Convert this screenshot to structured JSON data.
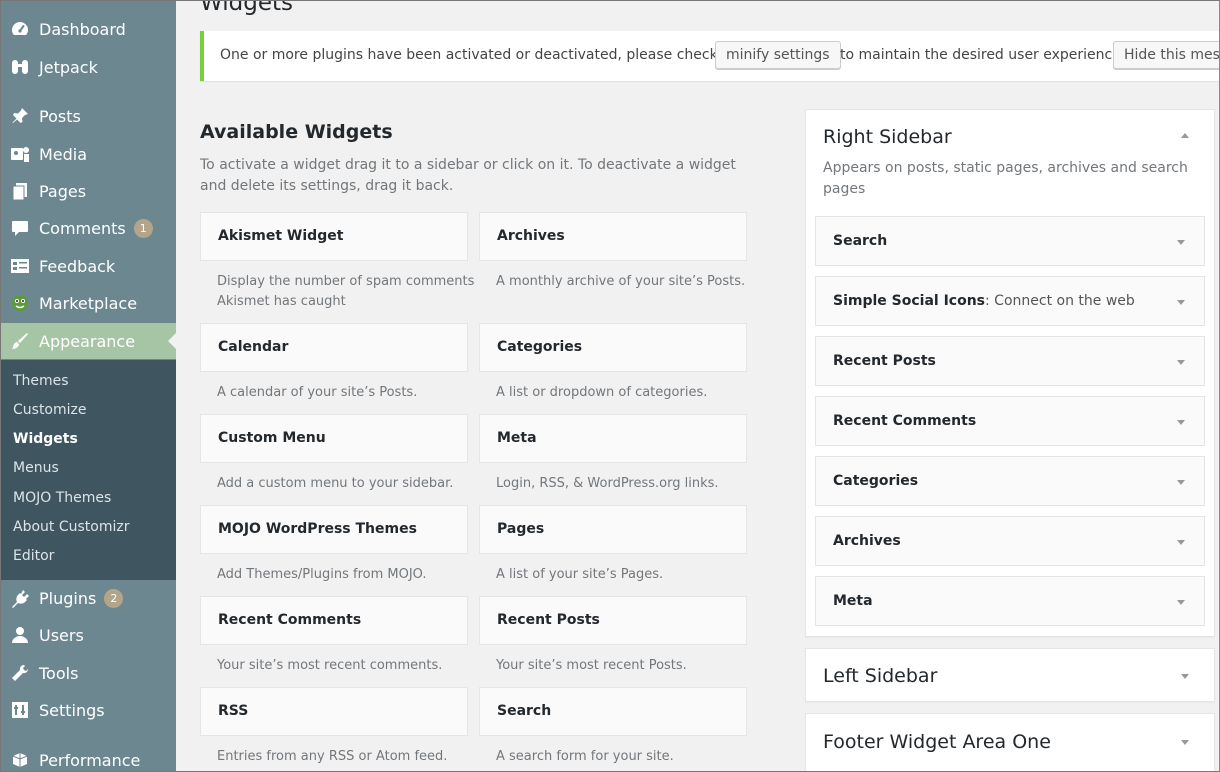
{
  "menu": {
    "dashboard": "Dashboard",
    "jetpack": "Jetpack",
    "posts": "Posts",
    "media": "Media",
    "pages": "Pages",
    "comments": "Comments",
    "comments_count": "1",
    "feedback": "Feedback",
    "marketplace": "Marketplace",
    "appearance": "Appearance",
    "plugins": "Plugins",
    "plugins_count": "2",
    "users": "Users",
    "tools": "Tools",
    "settings": "Settings",
    "performance": "Performance"
  },
  "submenu": {
    "themes": "Themes",
    "customize": "Customize",
    "widgets": "Widgets",
    "menus": "Menus",
    "mojo_themes": "MOJO Themes",
    "about_customizr": "About Customizr",
    "editor": "Editor"
  },
  "page_title": "Widgets",
  "notice": {
    "text_before": "One or more plugins have been activated or deactivated, please check the",
    "button": "minify settings",
    "text_after": "to maintain the desired user experience.",
    "hide_button": "Hide this message"
  },
  "available": {
    "title": "Available Widgets",
    "description": "To activate a widget drag it to a sidebar or click on it. To deactivate a widget and delete its settings, drag it back.",
    "widgets": [
      {
        "title": "Akismet Widget",
        "desc": "Display the number of spam comments Akismet has caught"
      },
      {
        "title": "Archives",
        "desc": "A monthly archive of your site’s Posts."
      },
      {
        "title": "Calendar",
        "desc": "A calendar of your site’s Posts."
      },
      {
        "title": "Categories",
        "desc": "A list or dropdown of categories."
      },
      {
        "title": "Custom Menu",
        "desc": "Add a custom menu to your sidebar."
      },
      {
        "title": "Meta",
        "desc": "Login, RSS, & WordPress.org links."
      },
      {
        "title": "MOJO WordPress Themes",
        "desc": "Add Themes/Plugins from MOJO."
      },
      {
        "title": "Pages",
        "desc": "A list of your site’s Pages."
      },
      {
        "title": "Recent Comments",
        "desc": "Your site’s most recent comments."
      },
      {
        "title": "Recent Posts",
        "desc": "Your site’s most recent Posts."
      },
      {
        "title": "RSS",
        "desc": "Entries from any RSS or Atom feed."
      },
      {
        "title": "Search",
        "desc": "A search form for your site."
      }
    ]
  },
  "right_sidebar": {
    "title": "Right Sidebar",
    "description": "Appears on posts, static pages, archives and search pages",
    "widgets": [
      {
        "title": "Search",
        "subtitle": ""
      },
      {
        "title": "Simple Social Icons",
        "subtitle": ": Connect on the web"
      },
      {
        "title": "Recent Posts",
        "subtitle": ""
      },
      {
        "title": "Recent Comments",
        "subtitle": ""
      },
      {
        "title": "Categories",
        "subtitle": ""
      },
      {
        "title": "Archives",
        "subtitle": ""
      },
      {
        "title": "Meta",
        "subtitle": ""
      }
    ]
  },
  "left_sidebar": {
    "title": "Left Sidebar"
  },
  "footer_area_one": {
    "title": "Footer Widget Area One"
  },
  "colors": {
    "sidebar_bg": "#6d8791",
    "submenu_bg": "#3f5560",
    "active_bg": "#a6c5a5",
    "notice_border": "#7ad03a"
  }
}
